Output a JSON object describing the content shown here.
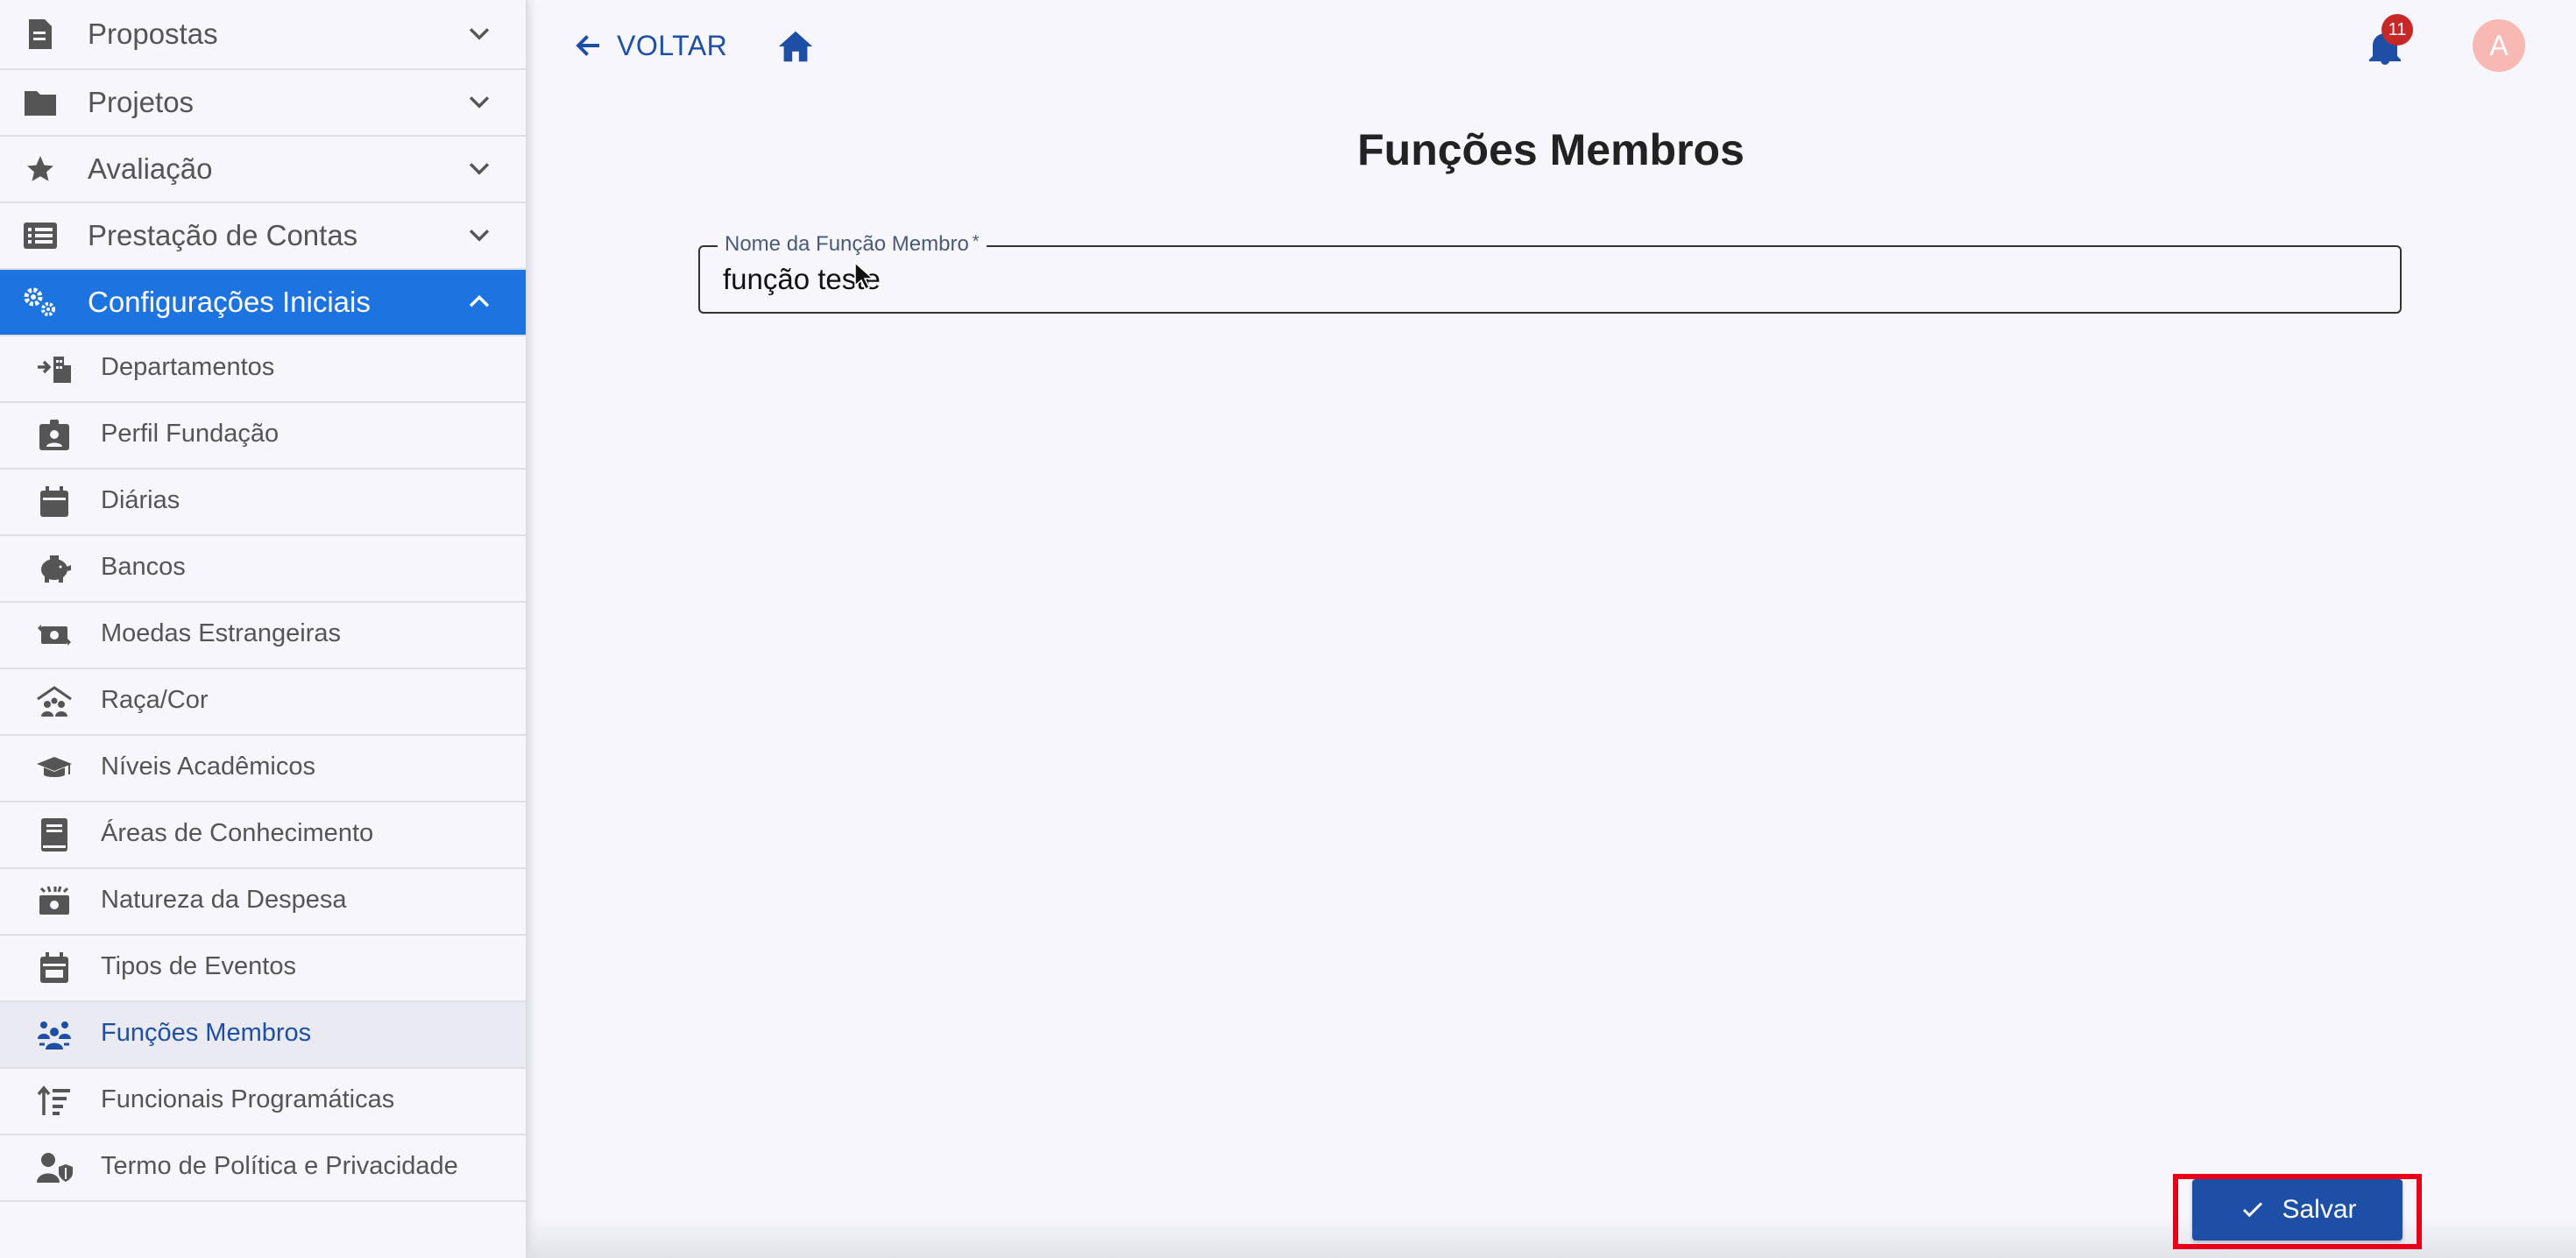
{
  "sidebar": {
    "menus": [
      {
        "label": "Propostas",
        "icon": "document-icon"
      },
      {
        "label": "Projetos",
        "icon": "folder-icon"
      },
      {
        "label": "Avaliação",
        "icon": "star-icon"
      },
      {
        "label": "Prestação de Contas",
        "icon": "list-icon"
      },
      {
        "label": "Configurações Iniciais",
        "icon": "gears-icon",
        "expanded": true
      }
    ],
    "sub_items": [
      {
        "label": "Departamentos",
        "icon": "building-arrow-icon"
      },
      {
        "label": "Perfil Fundação",
        "icon": "id-badge-icon"
      },
      {
        "label": "Diárias",
        "icon": "calendar-icon"
      },
      {
        "label": "Bancos",
        "icon": "piggy-bank-icon"
      },
      {
        "label": "Moedas Estrangeiras",
        "icon": "money-exchange-icon"
      },
      {
        "label": "Raça/Cor",
        "icon": "people-roof-icon"
      },
      {
        "label": "Níveis Acadêmicos",
        "icon": "graduation-cap-icon"
      },
      {
        "label": "Áreas de Conhecimento",
        "icon": "book-icon"
      },
      {
        "label": "Natureza da Despesa",
        "icon": "money-bills-icon"
      },
      {
        "label": "Tipos de Eventos",
        "icon": "calendar-event-icon"
      },
      {
        "label": "Funções Membros",
        "icon": "people-group-icon",
        "selected": true
      },
      {
        "label": "Funcionais Programáticas",
        "icon": "sort-lines-icon"
      },
      {
        "label": "Termo de Política e Privacidade",
        "icon": "user-shield-icon"
      }
    ]
  },
  "topbar": {
    "back_label": "VOLTAR",
    "notification_count": "11",
    "avatar_initial": "A"
  },
  "main": {
    "title": "Funções Membros",
    "field": {
      "label": "Nome da Função Membro",
      "required_mark": "*",
      "value": "função teste"
    },
    "save_label": "Salvar"
  },
  "colors": {
    "accent": "#1d74e0",
    "primary_button": "#1d4fa6",
    "highlight_border": "#e8001a",
    "badge": "#c62828",
    "avatar": "#f8b9b5"
  }
}
